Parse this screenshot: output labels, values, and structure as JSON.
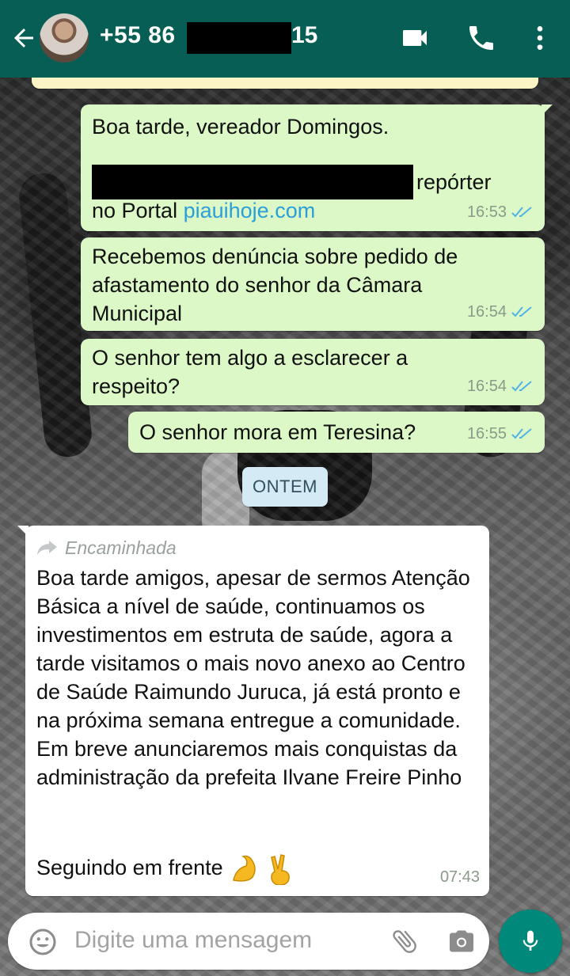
{
  "header": {
    "contact_prefix": "+55 86",
    "contact_suffix": "15",
    "background_color": "#075e54"
  },
  "messages": {
    "m1": {
      "line1": "Boa tarde, vereador Domingos.",
      "after_redaction": "repórter",
      "line3_prefix": "no Portal",
      "link": "piauihoje.com",
      "time": "16:53"
    },
    "m2": {
      "text": "Recebemos denúncia sobre pedido de afastamento do senhor da Câmara Municipal",
      "time": "16:54"
    },
    "m3": {
      "text": "O senhor tem algo a esclarecer a respeito?",
      "time": "16:54"
    },
    "m4": {
      "text": "O senhor mora em Teresina?",
      "time": "16:55"
    },
    "date_chip": "ONTEM",
    "forwarded": {
      "label": "Encaminhada",
      "text": "Boa tarde amigos, apesar de sermos Atenção Básica a nível de saúde, continuamos os investimentos em estruta de saúde, agora a tarde visitamos o mais novo anexo ao Centro de Saúde Raimundo Juruca, já está pronto e na próxima semana entregue a comunidade. Em breve anunciaremos mais conquistas da administração da prefeita Ilvane Freire Pinho",
      "closing": "Seguindo em frente",
      "time": "07:43"
    }
  },
  "composer": {
    "placeholder": "Digite uma mensagem",
    "accent_color": "#00897b"
  },
  "icons": [
    "back-arrow-icon",
    "video-call-icon",
    "phone-icon",
    "more-options-icon",
    "double-check-icon",
    "forward-arrow-icon",
    "emoji-icon",
    "attach-clip-icon",
    "camera-icon",
    "mic-icon"
  ]
}
